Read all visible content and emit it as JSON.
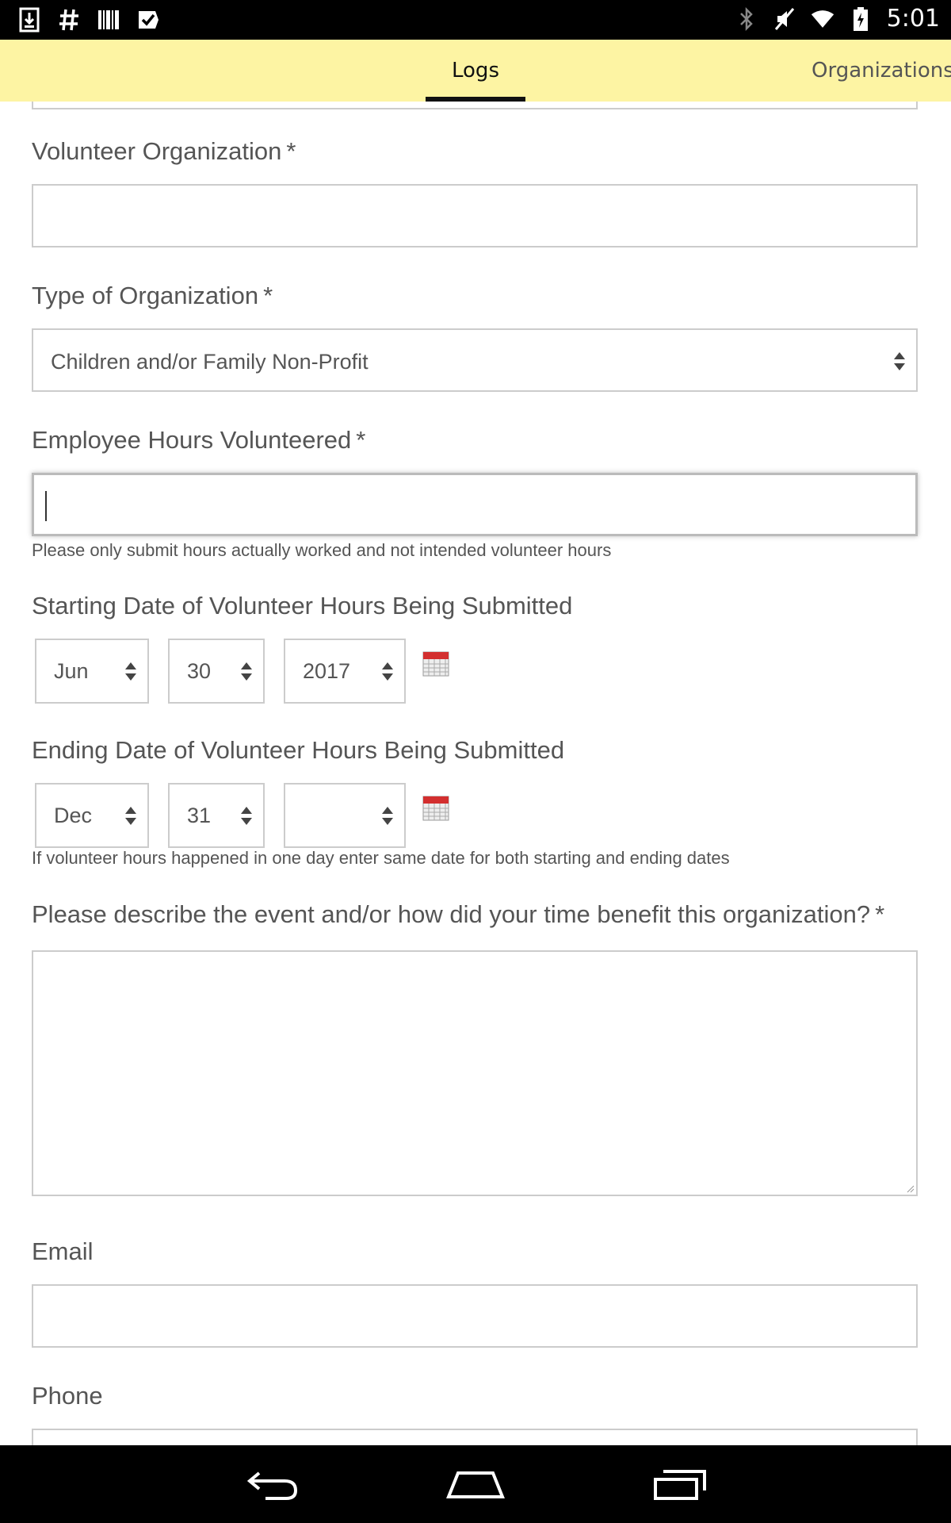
{
  "status_bar": {
    "time": "5:01",
    "left_icons": [
      "download-icon",
      "hashtag-icon",
      "barcode-icon",
      "checkmark-app-icon"
    ],
    "right_icons": [
      "bluetooth-icon",
      "mute-icon",
      "wifi-icon",
      "battery-charging-icon"
    ]
  },
  "tabs": {
    "logs": "Logs",
    "organizations": "Organizations",
    "active": "Logs"
  },
  "form": {
    "required_mark": "*",
    "volunteer_org": {
      "label": "Volunteer Organization",
      "value": ""
    },
    "org_type": {
      "label": "Type of Organization",
      "value": "Children and/or Family Non-Profit"
    },
    "hours": {
      "label": "Employee Hours Volunteered",
      "value": "",
      "help": "Please only submit hours actually worked and not intended volunteer hours"
    },
    "start_date": {
      "label": "Starting Date of Volunteer Hours Being Submitted",
      "month": "Jun",
      "day": "30",
      "year": "2017"
    },
    "end_date": {
      "label": "Ending Date of Volunteer Hours Being Submitted",
      "month": "Dec",
      "day": "31",
      "year": "",
      "help": "If volunteer hours happened in one day enter same date for both starting and ending dates"
    },
    "description": {
      "label": "Please describe the event and/or how did your time benefit this organization?",
      "value": ""
    },
    "email": {
      "label": "Email",
      "value": ""
    },
    "phone": {
      "label": "Phone",
      "value": ""
    }
  },
  "nav_bar": {
    "buttons": [
      "back-icon",
      "home-icon",
      "recents-icon"
    ]
  }
}
